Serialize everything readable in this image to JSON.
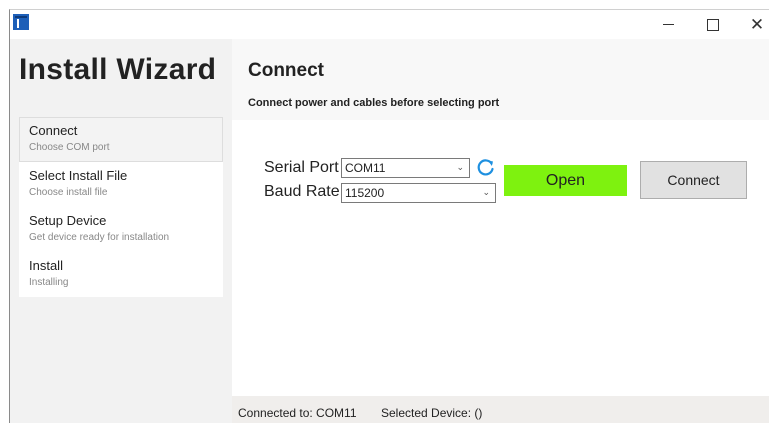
{
  "window": {
    "icons": {
      "app": "app-icon",
      "minimize": "minimize-icon",
      "maximize": "maximize-icon",
      "close": "close-icon"
    },
    "close_glyph": "✕"
  },
  "sidebar": {
    "title": "Install Wizard",
    "steps": [
      {
        "label": "Connect",
        "sub": "Choose COM port",
        "active": true
      },
      {
        "label": "Select Install File",
        "sub": "Choose install file",
        "active": false
      },
      {
        "label": "Setup Device",
        "sub": "Get device ready for installation",
        "active": false
      },
      {
        "label": "Install",
        "sub": "Installing",
        "active": false
      }
    ]
  },
  "main": {
    "title": "Connect",
    "subtitle": "Connect power and cables before selecting port",
    "serial_port": {
      "label": "Serial Port",
      "value": "COM11"
    },
    "baud_rate": {
      "label": "Baud Rate",
      "value": "115200"
    },
    "open_label": "Open",
    "connect_label": "Connect",
    "colors": {
      "open_button": "#7ef20f",
      "refresh_icon": "#1e90e0"
    }
  },
  "status": {
    "connected": "Connected to: COM11",
    "device": "Selected Device: ()"
  }
}
